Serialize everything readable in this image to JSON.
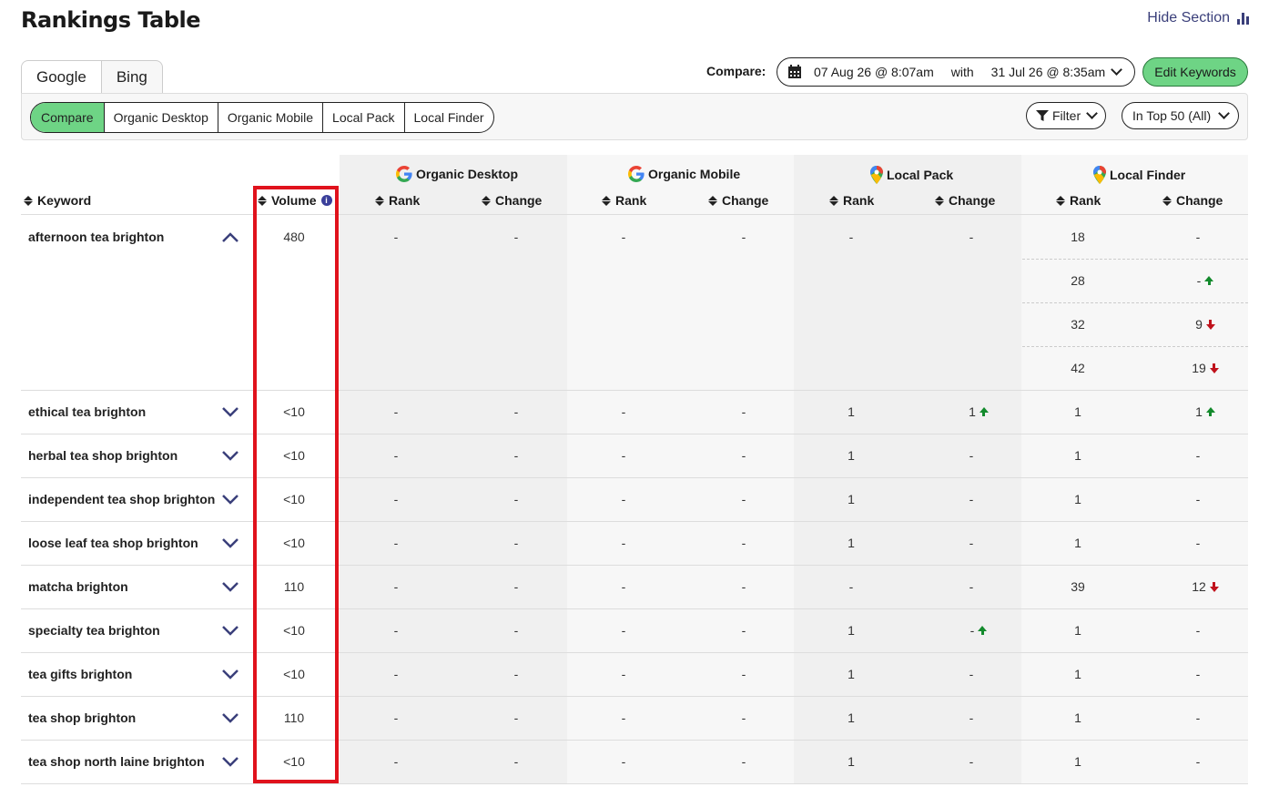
{
  "title": "Rankings Table",
  "hide_section": "Hide Section",
  "engine_tabs": [
    "Google",
    "Bing"
  ],
  "segments": [
    "Compare",
    "Organic Desktop",
    "Organic Mobile",
    "Local Pack",
    "Local Finder"
  ],
  "filter_label": "Filter",
  "top_filter": "In Top 50 (All)",
  "compare": {
    "label": "Compare:",
    "date_a": "07 Aug 26 @ 8:07am",
    "with": "with",
    "date_b": "31 Jul 26 @ 8:35am"
  },
  "edit_keywords": "Edit Keywords",
  "columns": {
    "keyword": "Keyword",
    "volume": "Volume",
    "groups": [
      {
        "name": "Organic Desktop",
        "icon": "google-icon"
      },
      {
        "name": "Organic Mobile",
        "icon": "google-icon"
      },
      {
        "name": "Local Pack",
        "icon": "maps-pin-icon"
      },
      {
        "name": "Local Finder",
        "icon": "maps-pin-icon"
      }
    ],
    "rank": "Rank",
    "change": "Change"
  },
  "colors": {
    "accent_green": "#6ed485",
    "up": "#138a2c",
    "down": "#c0121c",
    "highlight_box": "#e0121c",
    "link": "#3a3f7a"
  },
  "rows": [
    {
      "keyword": "afternoon tea brighton",
      "expanded": true,
      "volume": "480",
      "od": [
        "-",
        "-"
      ],
      "om": [
        "-",
        "-"
      ],
      "lp": [
        "-",
        "-"
      ],
      "lf": [
        [
          "18",
          "-",
          ""
        ],
        [
          "28",
          "-",
          "up"
        ],
        [
          "32",
          "9",
          "down"
        ],
        [
          "42",
          "19",
          "down"
        ]
      ]
    },
    {
      "keyword": "ethical tea brighton",
      "volume": "<10",
      "od": [
        "-",
        "-"
      ],
      "om": [
        "-",
        "-"
      ],
      "lp": [
        "1",
        "1",
        "up"
      ],
      "lf": [
        [
          "1",
          "1",
          "up"
        ]
      ]
    },
    {
      "keyword": "herbal tea shop brighton",
      "volume": "<10",
      "od": [
        "-",
        "-"
      ],
      "om": [
        "-",
        "-"
      ],
      "lp": [
        "1",
        "-"
      ],
      "lf": [
        [
          "1",
          "-",
          ""
        ]
      ]
    },
    {
      "keyword": "independent tea shop brighton",
      "volume": "<10",
      "od": [
        "-",
        "-"
      ],
      "om": [
        "-",
        "-"
      ],
      "lp": [
        "1",
        "-"
      ],
      "lf": [
        [
          "1",
          "-",
          ""
        ]
      ]
    },
    {
      "keyword": "loose leaf tea shop brighton",
      "volume": "<10",
      "od": [
        "-",
        "-"
      ],
      "om": [
        "-",
        "-"
      ],
      "lp": [
        "1",
        "-"
      ],
      "lf": [
        [
          "1",
          "-",
          ""
        ]
      ]
    },
    {
      "keyword": "matcha brighton",
      "volume": "110",
      "od": [
        "-",
        "-"
      ],
      "om": [
        "-",
        "-"
      ],
      "lp": [
        "-",
        "-"
      ],
      "lf": [
        [
          "39",
          "12",
          "down"
        ]
      ]
    },
    {
      "keyword": "specialty tea brighton",
      "volume": "<10",
      "od": [
        "-",
        "-"
      ],
      "om": [
        "-",
        "-"
      ],
      "lp": [
        "1",
        "-",
        "up"
      ],
      "lf": [
        [
          "1",
          "-",
          ""
        ]
      ]
    },
    {
      "keyword": "tea gifts brighton",
      "volume": "<10",
      "od": [
        "-",
        "-"
      ],
      "om": [
        "-",
        "-"
      ],
      "lp": [
        "1",
        "-"
      ],
      "lf": [
        [
          "1",
          "-",
          ""
        ]
      ]
    },
    {
      "keyword": "tea shop brighton",
      "volume": "110",
      "od": [
        "-",
        "-"
      ],
      "om": [
        "-",
        "-"
      ],
      "lp": [
        "1",
        "-"
      ],
      "lf": [
        [
          "1",
          "-",
          ""
        ]
      ]
    },
    {
      "keyword": "tea shop north laine brighton",
      "volume": "<10",
      "od": [
        "-",
        "-"
      ],
      "om": [
        "-",
        "-"
      ],
      "lp": [
        "1",
        "-"
      ],
      "lf": [
        [
          "1",
          "-",
          ""
        ]
      ]
    }
  ]
}
